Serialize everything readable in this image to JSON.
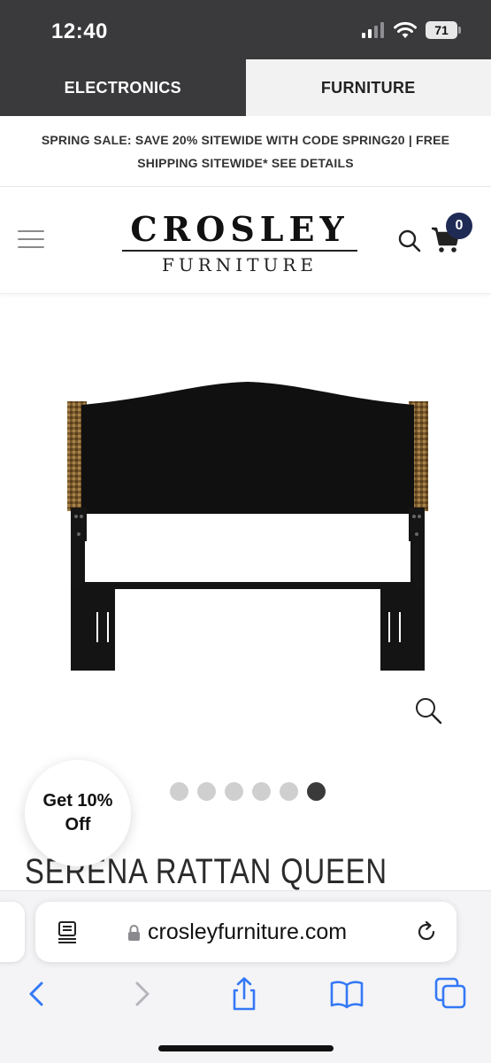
{
  "status_bar": {
    "time": "12:40",
    "battery": "71"
  },
  "store_tabs": [
    {
      "label": "ELECTRONICS",
      "active": false
    },
    {
      "label": "FURNITURE",
      "active": true
    }
  ],
  "promo": {
    "text": "SPRING SALE: SAVE 20% SITEWIDE WITH CODE SPRING20 | FREE SHIPPING SITEWIDE* SEE DETAILS"
  },
  "header": {
    "logo_main": "CROSLEY",
    "logo_sub": "FURNITURE",
    "cart_count": "0",
    "icons": {
      "menu": "hamburger-icon",
      "search": "search-icon",
      "cart": "cart-icon"
    }
  },
  "gallery": {
    "slide_count": 6,
    "active_slide": 6,
    "zoom_icon": "magnifier-icon"
  },
  "discount": {
    "line1": "Get 10%",
    "line2": "Off"
  },
  "product": {
    "title": "SERENA RATTAN QUEEN"
  },
  "browser": {
    "url": "crosleyfurniture.com",
    "icons": [
      "reader-icon",
      "lock-icon",
      "reload-icon",
      "back-icon",
      "forward-icon",
      "share-icon",
      "bookmarks-icon",
      "tabs-icon"
    ]
  },
  "colors": {
    "status_bg": "#3a3a3c",
    "badge": "#1f2a55",
    "ios_blue": "#3478f6"
  }
}
